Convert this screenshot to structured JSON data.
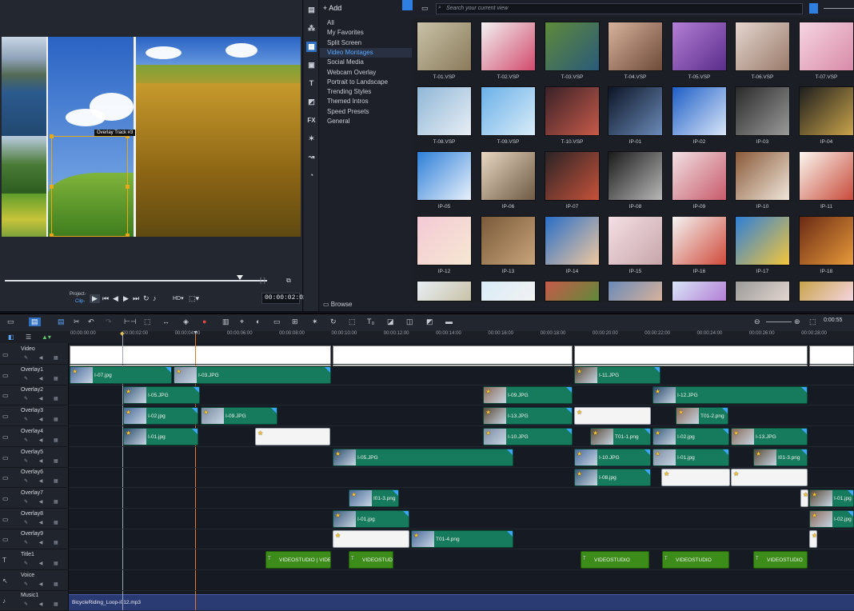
{
  "preview": {
    "overlay_tag": "Overlay Track #3",
    "project_label": "Project-",
    "clip_label": "Clip-",
    "timecode": "00:00:02:024"
  },
  "library": {
    "add_label": "Add",
    "browse_label": "Browse",
    "search_placeholder": "Search your current view",
    "nav_items": [
      "All",
      "My Favorites",
      "Split Screen",
      "Video Montages",
      "Social Media",
      "Webcam Overlay",
      "Portrait to Landscape",
      "Trending Styles",
      "Themed Intros",
      "Speed Presets",
      "General"
    ],
    "selected_nav": "Video Montages",
    "tiles": [
      "T-01.VSP",
      "T-02.VSP",
      "T-03.VSP",
      "T-04.VSP",
      "T-05.VSP",
      "T-06.VSP",
      "T-07.VSP",
      "T-08.VSP",
      "T-09.VSP",
      "T-10.VSP",
      "IP-01",
      "IP-02",
      "IP-03",
      "IP-04",
      "IP-05",
      "IP-06",
      "IP-07",
      "IP-08",
      "IP-09",
      "IP-10",
      "IP-11",
      "IP-12",
      "IP-13",
      "IP-14",
      "IP-15",
      "IP-16",
      "IP-17",
      "IP-18"
    ],
    "side_icons": [
      "media-icon",
      "instant-project-icon",
      "template-icon",
      "transition-icon",
      "title-icon",
      "graphic-icon",
      "fx-icon",
      "path-icon",
      "motion-icon",
      "speed-icon"
    ]
  },
  "timeline": {
    "ruler_ticks": [
      "00:00:00:00",
      "00:00:02:00",
      "00:00:04:00",
      "00:00:06:00",
      "00:00:08:00",
      "00:00:10:00",
      "00:00:12:00",
      "00:00:14:00",
      "00:00:16:00",
      "00:00:18:00",
      "00:00:20:00",
      "00:00:22:00",
      "00:00:24:00",
      "00:00:26:00",
      "00:00:28:00"
    ],
    "duration": "0:00:55",
    "tracks": [
      "Video",
      "Overlay1",
      "Overlay2",
      "Overlay3",
      "Overlay4",
      "Overlay5",
      "Overlay6",
      "Overlay7",
      "Overlay8",
      "Overlay9",
      "Title1",
      "Voice",
      "Music1"
    ],
    "clips": {
      "ov1_a": "I-07.jpg",
      "ov1_b": "I-03.JPG",
      "ov1_c": "I-11.JPG",
      "ov2_a": "I-05.JPG",
      "ov2_b": "I-09.JPG",
      "ov2_c": "I-12.JPG",
      "ov3_a": "I-02.jpg",
      "ov3_b": "I-09.JPG",
      "ov3_c": "I-13.JPG",
      "ov3_d": "T01-2.png",
      "ov4_a": "I-01.jpg",
      "ov4_b": "I-10.JPG",
      "ov4_c": "T01-1.png",
      "ov4_d": "I-02.jpg",
      "ov4_e": "I-13.JPG",
      "ov5_a": "I-05.JPG",
      "ov5_b": "I-10.JPG",
      "ov5_c": "I-01.jpg",
      "ov5_d": "I01-3.png",
      "ov6_a": "I-08.jpg",
      "ov7_a": "I01-3.png",
      "ov7_b": "I-01.jpg",
      "ov8_a": "I-01.jpg",
      "ov8_b": "I-02.jpg",
      "ov9_a": "T01-4.png",
      "t1_a": "VIDEOSTUDIO | VIDEOS",
      "t1_b": "VIDEOSTUDIO",
      "t1_c": "VIDEOSTUDIO",
      "t1_d": "VIDEOSTUDIO",
      "t1_e": "VIDEOSTUDIO",
      "music": "BicycleRiding_Loop-i012.mp3"
    }
  },
  "colors": {
    "accent": "#5da9ff",
    "clip": "#167a5c",
    "title_clip": "#3c8c19",
    "playhead": "#e07a2a"
  }
}
